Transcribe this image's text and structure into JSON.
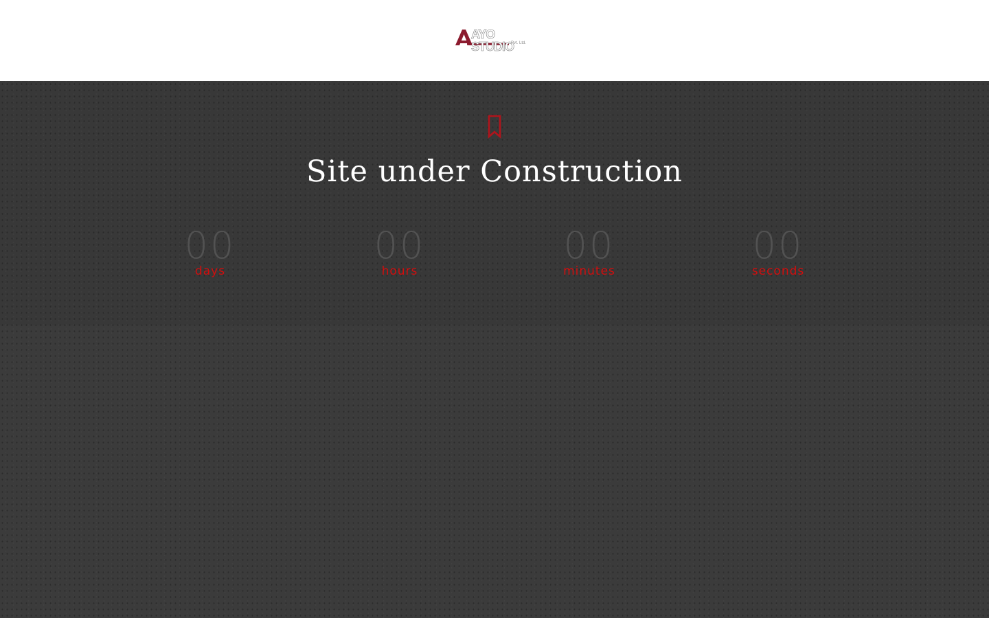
{
  "header": {
    "logo": {
      "text": "AYO STUDIO",
      "subtext": "Pvt. Ltd.",
      "accent_color": "#8c1b2e"
    }
  },
  "main": {
    "icon": "bookmark-icon",
    "icon_color": "#b0141c",
    "title": "Site under Construction",
    "countdown": [
      {
        "value": "00",
        "label": "days"
      },
      {
        "value": "00",
        "label": "hours"
      },
      {
        "value": "00",
        "label": "minutes"
      },
      {
        "value": "00",
        "label": "seconds"
      }
    ],
    "label_color": "#d40d0d",
    "number_color": "#525252"
  }
}
